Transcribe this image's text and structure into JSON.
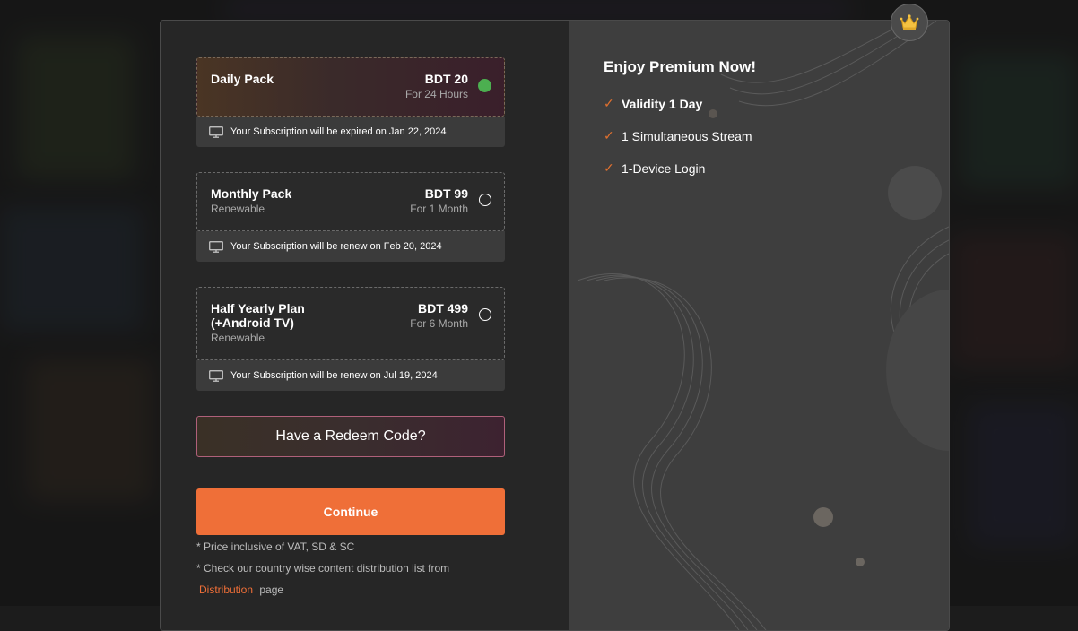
{
  "plans": [
    {
      "name": "Daily Pack",
      "name_line2": "",
      "subtitle": "",
      "price": "BDT 20",
      "period": "For 24 Hours",
      "selected": true,
      "note": "Your Subscription will be expired on Jan 22, 2024"
    },
    {
      "name": "Monthly Pack",
      "name_line2": "",
      "subtitle": "Renewable",
      "price": "BDT 99",
      "period": "For 1 Month",
      "selected": false,
      "note": "Your Subscription will be renew on Feb 20, 2024"
    },
    {
      "name": "Half Yearly Plan",
      "name_line2": "(+Android TV)",
      "subtitle": "Renewable",
      "price": "BDT 499",
      "period": "For 6 Month",
      "selected": false,
      "note": "Your Subscription will be renew on Jul 19, 2024"
    }
  ],
  "redeem_label": "Have a Redeem Code?",
  "continue_label": "Continue",
  "footnotes": {
    "vat": "* Price inclusive of VAT, SD & SC",
    "distribution_prefix": "* Check our country wise content distribution list from",
    "distribution_link": "Distribution",
    "distribution_suffix": "page"
  },
  "premium": {
    "title": "Enjoy Premium Now!",
    "features": [
      "Validity 1 Day",
      "1 Simultaneous Stream",
      "1-Device Login"
    ]
  },
  "icons": {
    "crown": "crown-icon",
    "tv": "tv-icon",
    "check": "check-icon"
  },
  "colors": {
    "accent": "#ef6f38",
    "selected_radio": "#4caf50",
    "panel_left": "#262626",
    "panel_right": "#3e3e3e"
  }
}
